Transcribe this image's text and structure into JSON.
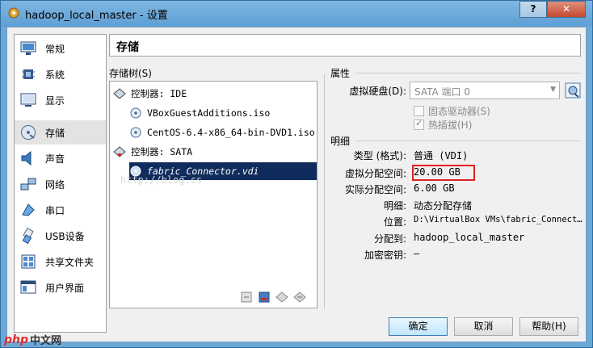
{
  "window": {
    "title": "hadoop_local_master - 设置",
    "help_label": "?",
    "close_label": "✕"
  },
  "sidebar": {
    "items": [
      {
        "label": "常规",
        "icon": "general-icon"
      },
      {
        "label": "系统",
        "icon": "system-icon"
      },
      {
        "label": "显示",
        "icon": "display-icon"
      },
      {
        "label": "存储",
        "icon": "storage-icon",
        "selected": true
      },
      {
        "label": "声音",
        "icon": "audio-icon"
      },
      {
        "label": "网络",
        "icon": "network-icon"
      },
      {
        "label": "串口",
        "icon": "serial-port-icon"
      },
      {
        "label": "USB设备",
        "icon": "usb-icon"
      },
      {
        "label": "共享文件夹",
        "icon": "shared-folder-icon"
      },
      {
        "label": "用户界面",
        "icon": "user-interface-icon"
      }
    ]
  },
  "page": {
    "title": "存储"
  },
  "tree": {
    "label": "存储树(S)",
    "rows": [
      {
        "text": "控制器: IDE",
        "kind": "controller"
      },
      {
        "text": "VBoxGuestAdditions.iso",
        "kind": "cd"
      },
      {
        "text": "CentOS-6.4-x86_64-bin-DVD1.iso",
        "kind": "cd"
      },
      {
        "text": "控制器: SATA",
        "kind": "controller"
      },
      {
        "text": "fabric_Connector.vdi",
        "kind": "disk",
        "selected": true
      }
    ],
    "watermark": "http://blog.cs"
  },
  "attributes": {
    "section_label": "属性",
    "hard_disk_label": "虚拟硬盘(D):",
    "hard_disk_value": "SATA 端口 0",
    "ssd_label": "固态驱动器(S)",
    "hotplug_label": "热插拔(H)"
  },
  "info": {
    "section_label": "明细",
    "rows": [
      {
        "label": "类型 (格式):",
        "value": "普通 (VDI)"
      },
      {
        "label": "虚拟分配空间:",
        "value": "20.00 GB"
      },
      {
        "label": "实际分配空间:",
        "value": "6.00 GB"
      },
      {
        "label": "明细:",
        "value": "动态分配存储"
      },
      {
        "label": "位置:",
        "value": "D:\\VirtualBox VMs\\fabric_Connect…"
      },
      {
        "label": "分配到:",
        "value": "hadoop_local_master"
      },
      {
        "label": "加密密钥:",
        "value": "—"
      }
    ]
  },
  "buttons": {
    "ok": "确定",
    "cancel": "取消",
    "help": "帮助(H)"
  },
  "logo": {
    "php": "php",
    "text": "中文网"
  }
}
